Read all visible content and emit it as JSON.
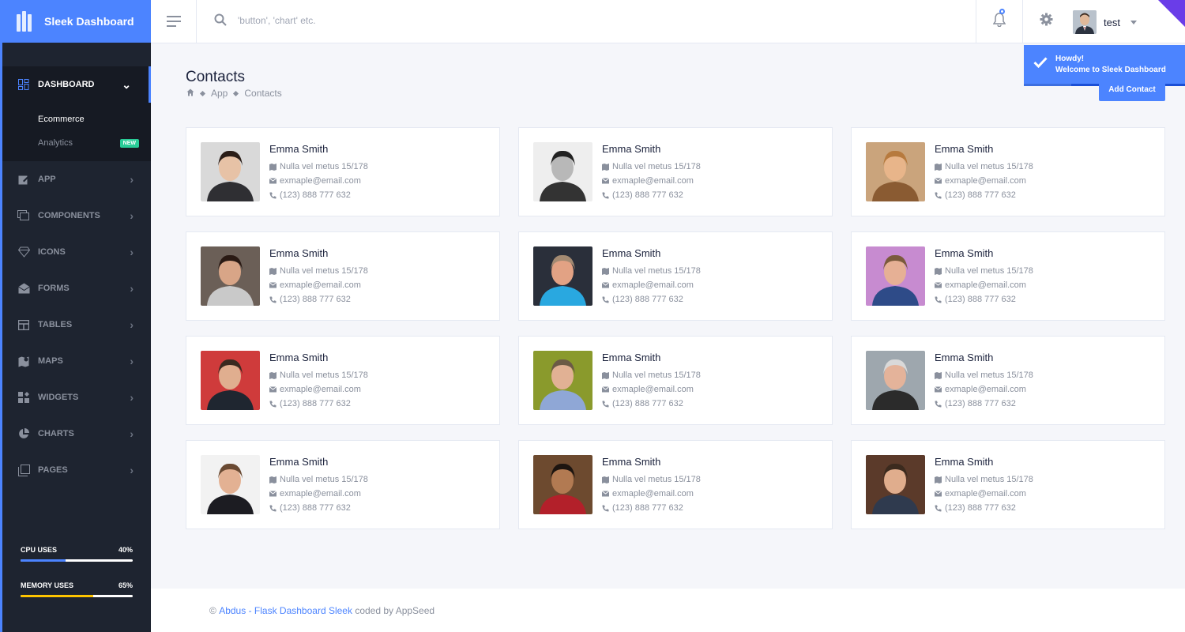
{
  "brand": {
    "name": "Sleek Dashboard",
    "accent": "#4c84ff"
  },
  "search": {
    "placeholder": "'button', 'chart' etc."
  },
  "user": {
    "name": "test"
  },
  "toast": {
    "title": "Howdy!",
    "message": "Welcome to Sleek Dashboard"
  },
  "sidebar": {
    "items": [
      {
        "label": "Dashboard",
        "icon": "dashboard-icon"
      },
      {
        "label": "App",
        "icon": "pencil-square-icon"
      },
      {
        "label": "Components",
        "icon": "layers-icon"
      },
      {
        "label": "Icons",
        "icon": "diamond-icon"
      },
      {
        "label": "Forms",
        "icon": "email-open-icon"
      },
      {
        "label": "Tables",
        "icon": "table-icon"
      },
      {
        "label": "Maps",
        "icon": "map-marker-icon"
      },
      {
        "label": "Widgets",
        "icon": "widgets-icon"
      },
      {
        "label": "Charts",
        "icon": "chart-pie-icon"
      },
      {
        "label": "Pages",
        "icon": "pages-icon"
      }
    ],
    "subitems": [
      {
        "label": "Ecommerce"
      },
      {
        "label": "Analytics",
        "badge": "NEW"
      }
    ],
    "usage": [
      {
        "label": "CPU USES",
        "value": "40%",
        "fraction": 0.4,
        "color": "#4c84ff"
      },
      {
        "label": "MEMORY USES",
        "value": "65%",
        "fraction": 0.65,
        "color": "#fec400"
      }
    ]
  },
  "page": {
    "title": "Contacts",
    "breadcrumb": [
      "App",
      "Contacts"
    ],
    "add_button": "Add Contact"
  },
  "contacts": [
    {
      "name": "Emma Smith",
      "address": "Nulla vel metus 15/178",
      "email": "exmaple@email.com",
      "phone": "(123) 888 777 632"
    },
    {
      "name": "Emma Smith",
      "address": "Nulla vel metus 15/178",
      "email": "exmaple@email.com",
      "phone": "(123) 888 777 632"
    },
    {
      "name": "Emma Smith",
      "address": "Nulla vel metus 15/178",
      "email": "exmaple@email.com",
      "phone": "(123) 888 777 632"
    },
    {
      "name": "Emma Smith",
      "address": "Nulla vel metus 15/178",
      "email": "exmaple@email.com",
      "phone": "(123) 888 777 632"
    },
    {
      "name": "Emma Smith",
      "address": "Nulla vel metus 15/178",
      "email": "exmaple@email.com",
      "phone": "(123) 888 777 632"
    },
    {
      "name": "Emma Smith",
      "address": "Nulla vel metus 15/178",
      "email": "exmaple@email.com",
      "phone": "(123) 888 777 632"
    },
    {
      "name": "Emma Smith",
      "address": "Nulla vel metus 15/178",
      "email": "exmaple@email.com",
      "phone": "(123) 888 777 632"
    },
    {
      "name": "Emma Smith",
      "address": "Nulla vel metus 15/178",
      "email": "exmaple@email.com",
      "phone": "(123) 888 777 632"
    },
    {
      "name": "Emma Smith",
      "address": "Nulla vel metus 15/178",
      "email": "exmaple@email.com",
      "phone": "(123) 888 777 632"
    },
    {
      "name": "Emma Smith",
      "address": "Nulla vel metus 15/178",
      "email": "exmaple@email.com",
      "phone": "(123) 888 777 632"
    },
    {
      "name": "Emma Smith",
      "address": "Nulla vel metus 15/178",
      "email": "exmaple@email.com",
      "phone": "(123) 888 777 632"
    },
    {
      "name": "Emma Smith",
      "address": "Nulla vel metus 15/178",
      "email": "exmaple@email.com",
      "phone": "(123) 888 777 632"
    }
  ],
  "footer": {
    "copyright": "©",
    "author": "Abdus",
    "sep": "-",
    "product": "Flask Dashboard Sleek",
    "suffix": "coded by AppSeed"
  }
}
